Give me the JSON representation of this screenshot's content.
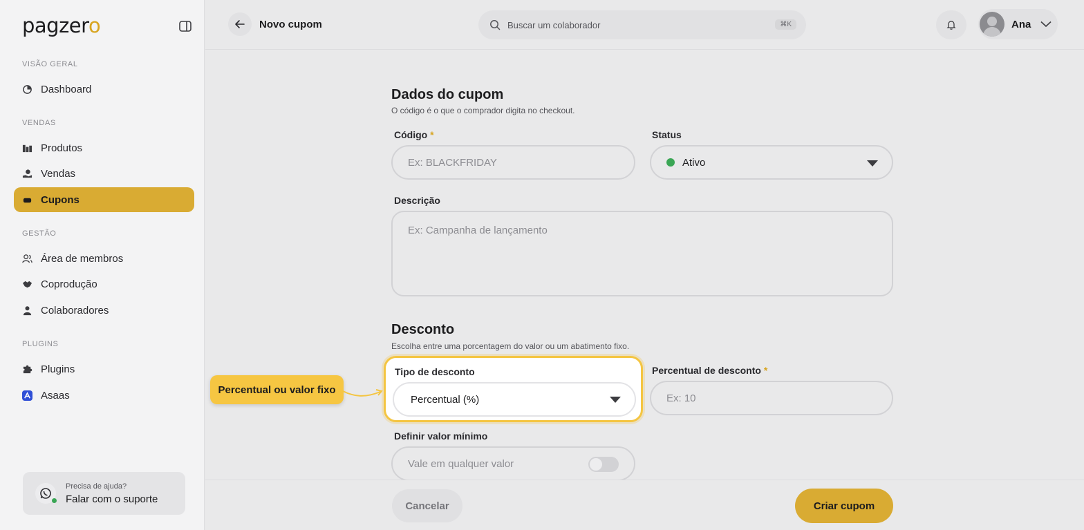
{
  "brand": {
    "logo_main": "pagzer",
    "logo_accent": "o",
    "accent_color": "#d9ab33"
  },
  "sidebar": {
    "sections": [
      {
        "title": "VISÃO GERAL",
        "items": [
          {
            "label": "Dashboard",
            "icon": "dashboard-icon"
          }
        ]
      },
      {
        "title": "VENDAS",
        "items": [
          {
            "label": "Produtos",
            "icon": "products-icon"
          },
          {
            "label": "Vendas",
            "icon": "sales-icon"
          },
          {
            "label": "Cupons",
            "icon": "coupon-icon",
            "active": true
          }
        ]
      },
      {
        "title": "GESTÃO",
        "items": [
          {
            "label": "Área de membros",
            "icon": "members-icon"
          },
          {
            "label": "Coprodução",
            "icon": "handshake-icon"
          },
          {
            "label": "Colaboradores",
            "icon": "user-icon"
          }
        ]
      },
      {
        "title": "PLUGINS",
        "items": [
          {
            "label": "Plugins",
            "icon": "puzzle-icon"
          },
          {
            "label": "Asaas",
            "icon": "asaas-icon"
          }
        ]
      }
    ],
    "support": {
      "small": "Precisa de ajuda?",
      "big": "Falar com o suporte"
    }
  },
  "header": {
    "title": "Novo cupom",
    "search_placeholder": "Buscar um colaborador",
    "shortcut": "⌘K",
    "user_name": "Ana"
  },
  "form": {
    "coupon_section": {
      "title": "Dados do cupom",
      "hint": "O código é o que o comprador digita no checkout.",
      "code_label": "Código",
      "code_placeholder": "Ex: BLACKFRIDAY",
      "status_label": "Status",
      "status_value": "Ativo",
      "status_color": "#3aa655",
      "description_label": "Descrição",
      "description_placeholder": "Ex: Campanha de lançamento"
    },
    "discount_section": {
      "title": "Desconto",
      "hint": "Escolha entre uma porcentagem do valor ou um abatimento fixo.",
      "type_label": "Tipo de desconto",
      "type_value": "Percentual (%)",
      "percent_label": "Percentual de desconto",
      "percent_placeholder": "Ex: 10",
      "min_label": "Definir valor mínimo",
      "min_placeholder": "Vale em qualquer valor",
      "min_toggle_on": false
    },
    "required_mark": "*"
  },
  "callout": {
    "text": "Percentual ou valor fixo"
  },
  "footer": {
    "cancel": "Cancelar",
    "create": "Criar cupom"
  }
}
